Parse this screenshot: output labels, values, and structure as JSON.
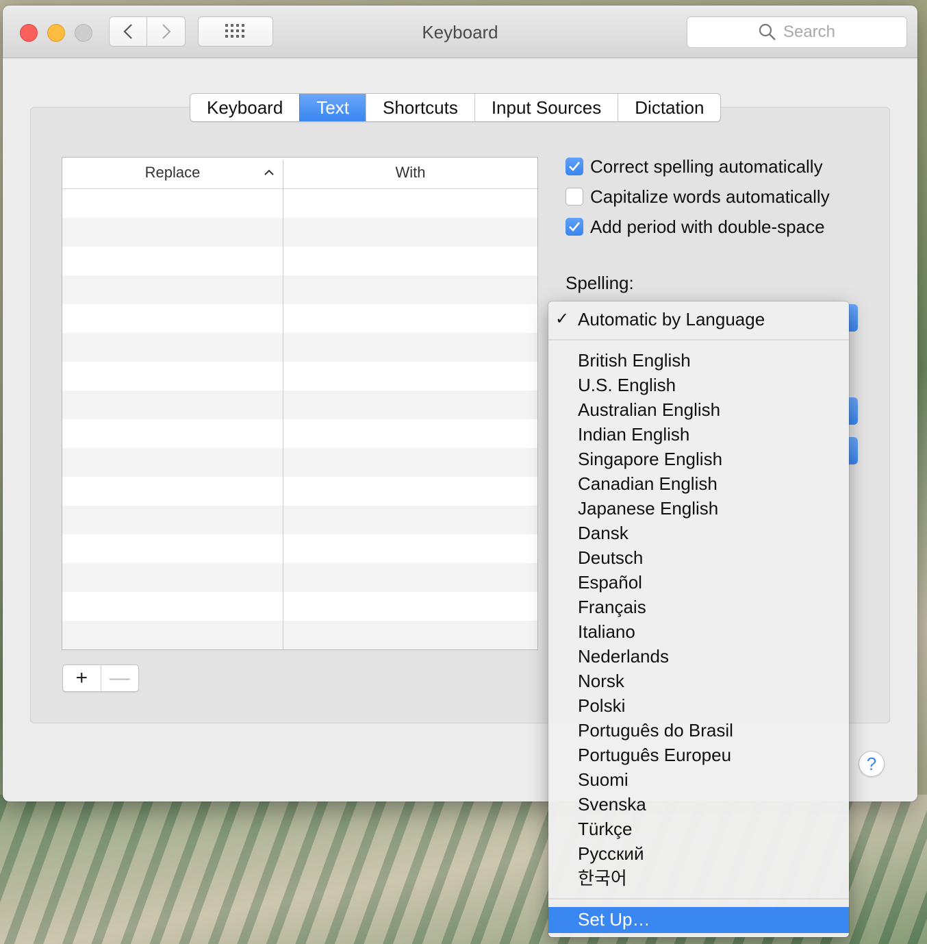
{
  "window": {
    "title": "Keyboard"
  },
  "toolbar": {
    "search_placeholder": "Search"
  },
  "tabs": [
    {
      "label": "Keyboard",
      "active": false
    },
    {
      "label": "Text",
      "active": true
    },
    {
      "label": "Shortcuts",
      "active": false
    },
    {
      "label": "Input Sources",
      "active": false
    },
    {
      "label": "Dictation",
      "active": false
    }
  ],
  "table": {
    "columns": [
      "Replace",
      "With"
    ],
    "rows": []
  },
  "options": [
    {
      "label": "Correct spelling automatically",
      "checked": true
    },
    {
      "label": "Capitalize words automatically",
      "checked": false
    },
    {
      "label": "Add period with double-space",
      "checked": true
    }
  ],
  "spelling": {
    "label": "Spelling:"
  },
  "menu": {
    "checked_item": "Automatic by Language",
    "languages": [
      "British English",
      "U.S. English",
      "Australian English",
      "Indian English",
      "Singapore English",
      "Canadian English",
      "Japanese English",
      "Dansk",
      "Deutsch",
      "Español",
      "Français",
      "Italiano",
      "Nederlands",
      "Norsk",
      "Polski",
      "Português do Brasil",
      "Português Europeu",
      "Suomi",
      "Svenska",
      "Türkçe",
      "Русский",
      "한국어"
    ],
    "setup_item": "Set Up…"
  },
  "help": {
    "label": "?"
  },
  "colors": {
    "accent": "#3b87f2"
  }
}
